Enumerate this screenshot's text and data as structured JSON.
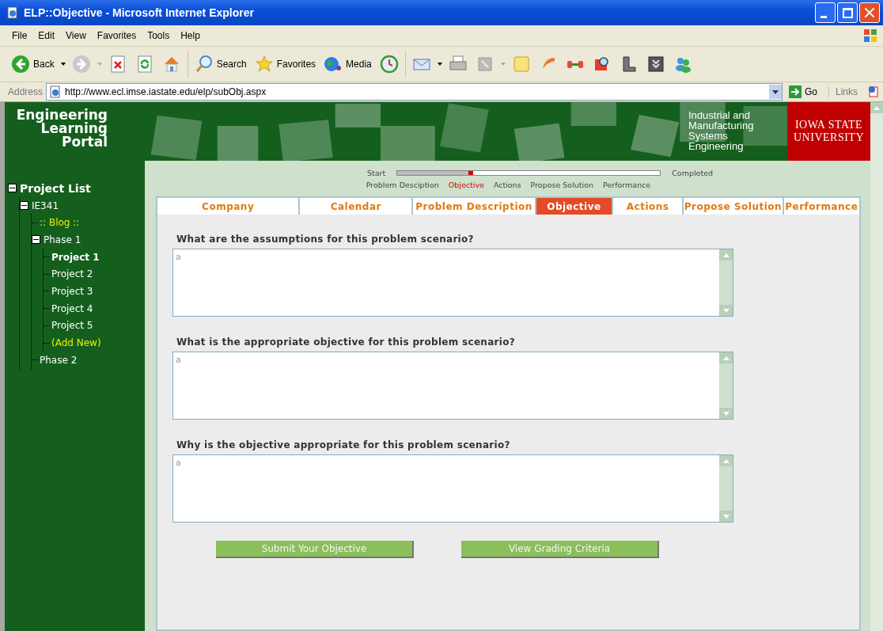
{
  "window": {
    "title": "ELP::Objective - Microsoft Internet Explorer"
  },
  "menu": [
    "File",
    "Edit",
    "View",
    "Favorites",
    "Tools",
    "Help"
  ],
  "toolbar": {
    "back": "Back",
    "search": "Search",
    "favorites": "Favorites",
    "media": "Media"
  },
  "address": {
    "label": "Address",
    "url": "http://www.ecl.imse.iastate.edu/elp/subObj.aspx",
    "go": "Go",
    "links": "Links"
  },
  "banner": {
    "logo": [
      "Engineering",
      "Learning",
      "Portal"
    ],
    "department": [
      "Industrial and",
      "Manufacturing",
      "Systems",
      "Engineering"
    ],
    "university": [
      "IOWA STATE",
      "UNIVERSITY"
    ]
  },
  "tree": {
    "label": "Project List",
    "expanded": true,
    "children": [
      {
        "label": "IE341",
        "kind": "item",
        "expanded": true,
        "selected": false,
        "children": [
          {
            "label": ":: Blog ::",
            "kind": "link",
            "selected": false
          },
          {
            "label": "Phase 1",
            "kind": "item",
            "expanded": true,
            "selected": false,
            "children": [
              {
                "label": "Project 1",
                "kind": "item",
                "selected": true
              },
              {
                "label": "Project 2",
                "kind": "item",
                "selected": false
              },
              {
                "label": "Project 3",
                "kind": "item",
                "selected": false
              },
              {
                "label": "Project 4",
                "kind": "item",
                "selected": false
              },
              {
                "label": "Project 5",
                "kind": "item",
                "selected": false
              },
              {
                "label": "(Add New)",
                "kind": "link",
                "selected": false
              }
            ]
          },
          {
            "label": "Phase 2",
            "kind": "item",
            "selected": false
          }
        ]
      }
    ]
  },
  "progress": {
    "start": "Start",
    "end": "Completed",
    "level": 0.27,
    "stages": [
      {
        "label": "Problem Desciption",
        "selected": false
      },
      {
        "label": "Objective",
        "selected": true
      },
      {
        "label": "Actions",
        "selected": false
      },
      {
        "label": "Propose Solution",
        "selected": false
      },
      {
        "label": "Performance",
        "selected": false
      }
    ]
  },
  "tabs": [
    {
      "label": "Company",
      "selected": false
    },
    {
      "label": "Calendar",
      "selected": false
    },
    {
      "label": "Problem Description",
      "selected": false
    },
    {
      "label": "Objective",
      "selected": true
    },
    {
      "label": "Actions",
      "selected": false
    },
    {
      "label": "Propose Solution",
      "selected": false
    },
    {
      "label": "Performance",
      "selected": false
    }
  ],
  "questions": [
    {
      "label": "What are the assumptions for this problem scenario?",
      "value": "a"
    },
    {
      "label": "What is the appropriate objective for this problem scenario?",
      "value": "a"
    },
    {
      "label": "Why is the objective appropriate for this problem scenario?",
      "value": "a"
    }
  ],
  "buttons": [
    "Submit Your Objective",
    "View Grading Criteria"
  ]
}
